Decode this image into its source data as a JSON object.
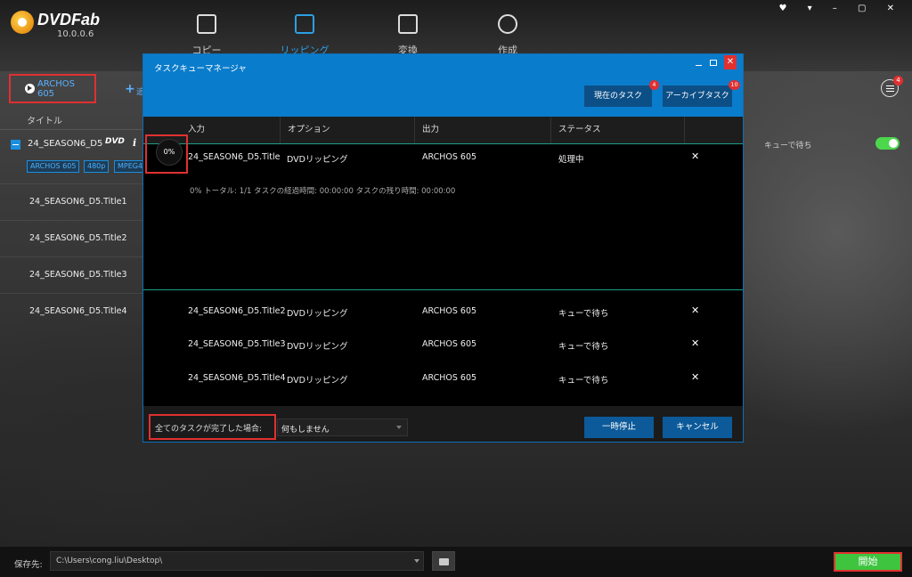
{
  "app": {
    "brand": "DVDFab",
    "version": "10.0.0.6",
    "nav": [
      {
        "label": "コピー",
        "active": false
      },
      {
        "label": "リッピング",
        "active": true
      },
      {
        "label": "変換",
        "active": false
      },
      {
        "label": "作成",
        "active": false
      }
    ],
    "window_controls": "♥ ▾ – ▢ ✕"
  },
  "left": {
    "profile_label": "ARCHOS 605",
    "add_label": "追",
    "title_header": "タイトル",
    "main_title": "24_SEASON6_D5",
    "disc_badge": "DVD",
    "tags": [
      "ARCHOS 605",
      "480p",
      "MPEG4"
    ],
    "titles": [
      "24_SEASON6_D5.Title1",
      "24_SEASON6_D5.Title2",
      "24_SEASON6_D5.Title3",
      "24_SEASON6_D5.Title4"
    ]
  },
  "right": {
    "queue_status": "キューで待ち",
    "queue_count": "4"
  },
  "bottom": {
    "save_label": "保存先:",
    "save_path": "C:\\Users\\cong.liu\\Desktop\\",
    "start_label": "開始"
  },
  "dialog": {
    "title": "タスクキューマネージャ",
    "tabs": [
      {
        "label": "現在のタスク",
        "badge": "4"
      },
      {
        "label": "アーカイブタスク",
        "badge": "10"
      }
    ],
    "columns": [
      "入力",
      "オプション",
      "出力",
      "ステータス"
    ],
    "current": {
      "progress": "0%",
      "input": "24_SEASON6_D5.Title",
      "option": "DVDリッピング",
      "output": "ARCHOS 605",
      "status": "処理中",
      "detail": "0%  トータル: 1/1 タスクの経過時間: 00:00:00 タスクの残り時間: 00:00:00"
    },
    "queued": [
      {
        "input": "24_SEASON6_D5.Title2",
        "option": "DVDリッピング",
        "output": "ARCHOS 605",
        "status": "キューで待ち"
      },
      {
        "input": "24_SEASON6_D5.Title3",
        "option": "DVDリッピング",
        "output": "ARCHOS 605",
        "status": "キューで待ち"
      },
      {
        "input": "24_SEASON6_D5.Title4",
        "option": "DVDリッピング",
        "output": "ARCHOS 605",
        "status": "キューで待ち"
      }
    ],
    "when_done_label": "全てのタスクが完了した場合:",
    "when_done_value": "何もしません",
    "pause_label": "一時停止",
    "cancel_label": "キャンセル",
    "remove_glyph": "✕"
  },
  "colors": {
    "accent": "#0a7ccc",
    "start_green": "#3ec43e",
    "highlight_red": "#e03030"
  }
}
